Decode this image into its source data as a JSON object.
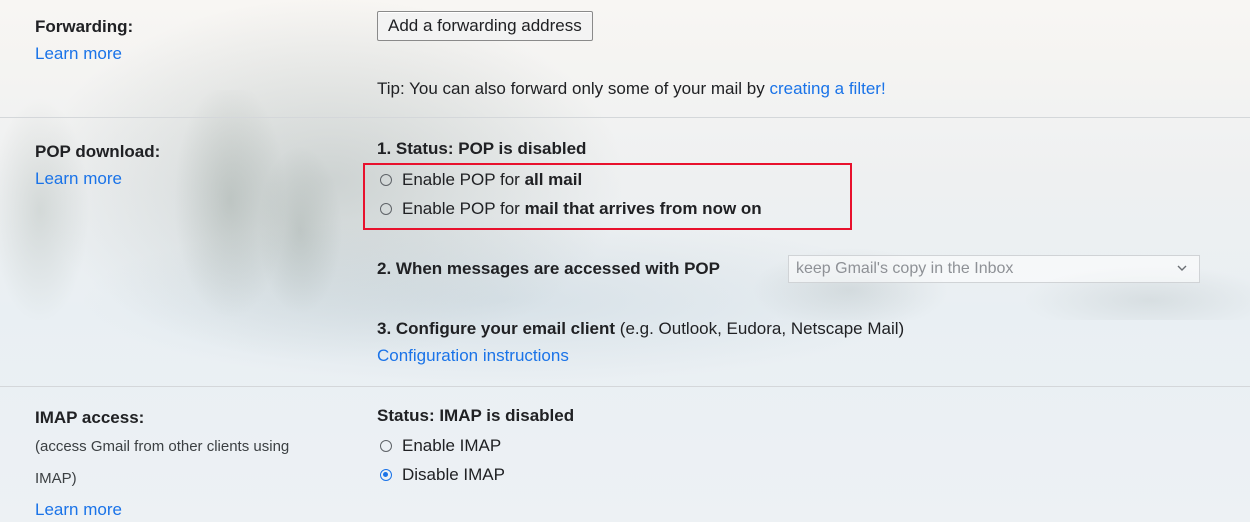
{
  "forwarding": {
    "label": "Forwarding:",
    "learn_more": "Learn more",
    "button": "Add a forwarding address",
    "tip_prefix": "Tip: You can also forward only some of your mail by ",
    "tip_link": "creating a filter!"
  },
  "pop": {
    "label": "POP download:",
    "learn_more": "Learn more",
    "status": "1. Status: POP is disabled",
    "option_all_prefix": "Enable POP for ",
    "option_all_bold": "all mail",
    "option_now_prefix": "Enable POP for ",
    "option_now_bold": "mail that arrives from now on",
    "access_label": "2. When messages are accessed with POP",
    "access_select_value": "keep Gmail's copy in the Inbox",
    "configure_bold": "3. Configure your email client",
    "configure_rest": " (e.g. Outlook, Eudora, Netscape Mail)",
    "config_link": "Configuration instructions"
  },
  "imap": {
    "label": "IMAP access:",
    "sub_line1": "(access Gmail from other clients using",
    "sub_line2": "IMAP)",
    "learn_more": "Learn more",
    "status": "Status: IMAP is disabled",
    "enable": "Enable IMAP",
    "disable": "Disable IMAP",
    "selected": "disable"
  },
  "colors": {
    "link": "#1a73e8",
    "highlight_box": "#e8112d",
    "radio_checked": "#1a73e8"
  }
}
